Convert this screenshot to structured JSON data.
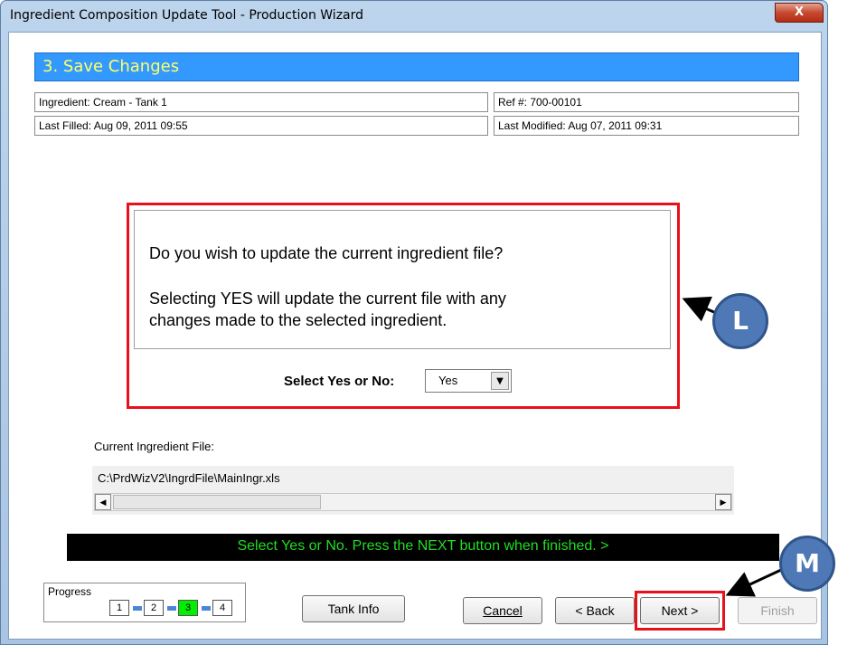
{
  "window": {
    "title": "Ingredient Composition Update Tool - Production Wizard",
    "close_label": "X"
  },
  "header": {
    "step_title": "3. Save Changes"
  },
  "info": {
    "ingredient": "Ingredient:  Cream - Tank 1",
    "ref": "Ref #: 700-00101",
    "last_filled": "Last Filled: Aug 09, 2011 09:55",
    "last_modified": "Last Modified: Aug 07, 2011 09:31"
  },
  "question": {
    "line1": "Do you wish to update the current ingredient file?",
    "line2": "Selecting YES will update the current file with any",
    "line3": "changes made to the selected ingredient."
  },
  "select": {
    "label": "Select Yes or No:",
    "value": "Yes"
  },
  "file": {
    "label": "Current Ingredient File:",
    "path": "C:\\PrdWizV2\\IngrdFile\\MainIngr.xls"
  },
  "status": {
    "message": "Select Yes or No.  Press the NEXT button when finished. >"
  },
  "progress": {
    "label": "Progress",
    "steps": [
      "1",
      "2",
      "3",
      "4"
    ],
    "current": "3",
    "active_color": "#00ee00"
  },
  "buttons": {
    "tank_info": "Tank Info",
    "cancel": "Cancel",
    "back": "< Back",
    "next": "Next >",
    "finish": "Finish"
  },
  "callouts": {
    "l": "L",
    "m": "M"
  },
  "colors": {
    "accent": "#3399ff",
    "highlight": "#e8101a",
    "status_text": "#22dd22",
    "callout": "#4f78b6"
  }
}
